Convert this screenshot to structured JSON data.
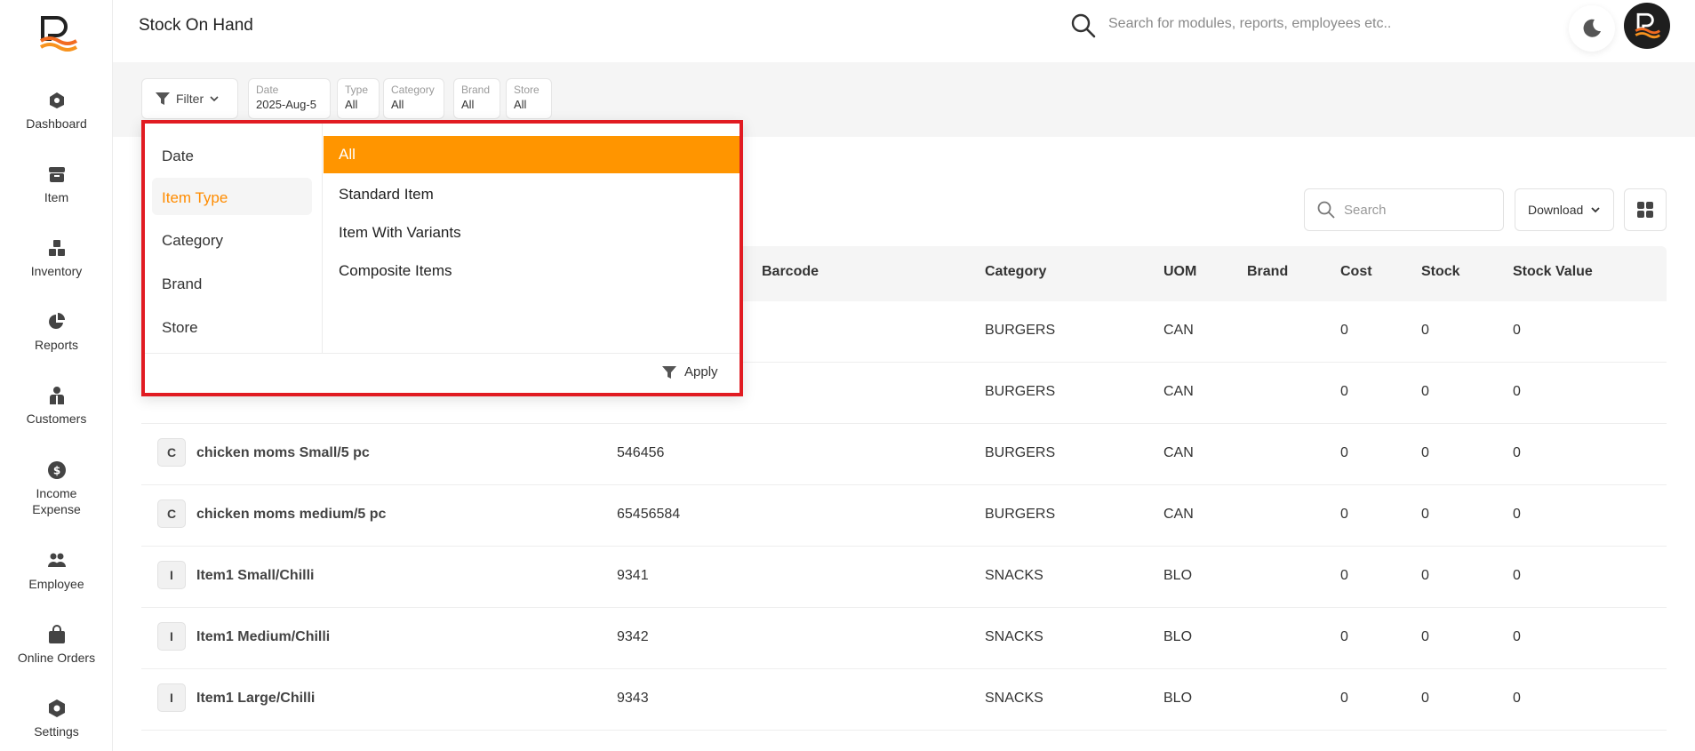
{
  "header": {
    "title": "Stock On Hand",
    "search_placeholder": "Search for modules, reports, employees etc.."
  },
  "sidebar": {
    "items": [
      {
        "label": "Dashboard"
      },
      {
        "label": "Item"
      },
      {
        "label": "Inventory"
      },
      {
        "label": "Reports"
      },
      {
        "label": "Customers"
      },
      {
        "label": "Income Expense"
      },
      {
        "label": "Employee"
      },
      {
        "label": "Online Orders"
      },
      {
        "label": "Settings"
      }
    ]
  },
  "filter": {
    "button_label": "Filter",
    "chips": [
      {
        "title": "Date",
        "value": "2025-Aug-5"
      },
      {
        "title": "Type",
        "value": "All"
      },
      {
        "title": "Category",
        "value": "All"
      },
      {
        "title": "Brand",
        "value": "All"
      },
      {
        "title": "Store",
        "value": "All"
      }
    ],
    "panel": {
      "groups": [
        "Date",
        "Item Type",
        "Category",
        "Brand",
        "Store"
      ],
      "active_group": "Item Type",
      "options": [
        "All",
        "Standard Item",
        "Item With Variants",
        "Composite Items"
      ],
      "selected_option": "All",
      "apply_label": "Apply"
    }
  },
  "toolbar": {
    "search_placeholder": "Search",
    "download_label": "Download"
  },
  "table": {
    "columns": [
      "Barcode",
      "Category",
      "UOM",
      "Brand",
      "Cost",
      "Stock",
      "Stock Value"
    ],
    "rows": [
      {
        "letter": "",
        "name": "",
        "barcode": "",
        "category": "BURGERS",
        "uom": "CAN",
        "brand": "",
        "cost": "0",
        "stock": "0",
        "value": "0"
      },
      {
        "letter": "",
        "name": "",
        "barcode": "",
        "category": "BURGERS",
        "uom": "CAN",
        "brand": "",
        "cost": "0",
        "stock": "0",
        "value": "0"
      },
      {
        "letter": "C",
        "name": "chicken moms Small/5 pc",
        "barcode": "546456",
        "category": "BURGERS",
        "uom": "CAN",
        "brand": "",
        "cost": "0",
        "stock": "0",
        "value": "0"
      },
      {
        "letter": "C",
        "name": "chicken moms medium/5 pc",
        "barcode": "65456584",
        "category": "BURGERS",
        "uom": "CAN",
        "brand": "",
        "cost": "0",
        "stock": "0",
        "value": "0"
      },
      {
        "letter": "I",
        "name": "Item1 Small/Chilli",
        "barcode": "9341",
        "category": "SNACKS",
        "uom": "BLO",
        "brand": "",
        "cost": "0",
        "stock": "0",
        "value": "0"
      },
      {
        "letter": "I",
        "name": "Item1 Medium/Chilli",
        "barcode": "9342",
        "category": "SNACKS",
        "uom": "BLO",
        "brand": "",
        "cost": "0",
        "stock": "0",
        "value": "0"
      },
      {
        "letter": "I",
        "name": "Item1 Large/Chilli",
        "barcode": "9343",
        "category": "SNACKS",
        "uom": "BLO",
        "brand": "",
        "cost": "0",
        "stock": "0",
        "value": "0"
      }
    ]
  },
  "colors": {
    "accent": "#ff9500",
    "highlight_border": "#e11b22"
  }
}
